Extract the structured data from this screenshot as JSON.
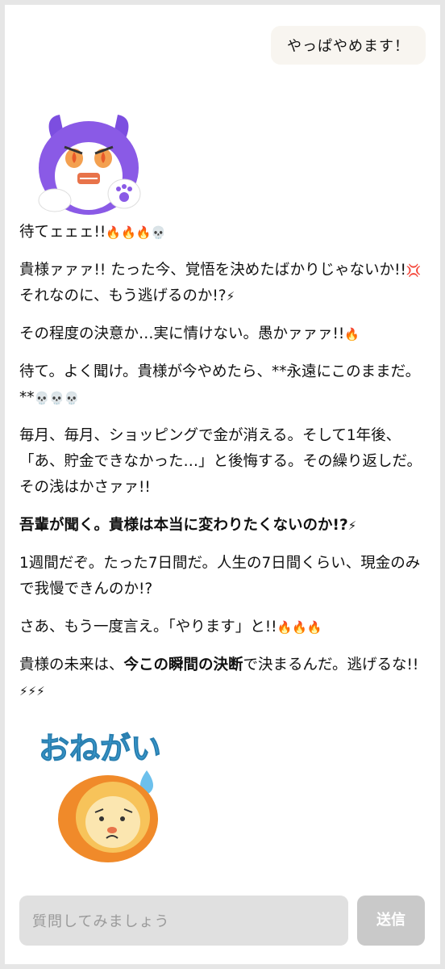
{
  "user_message": "やっぱやめます！",
  "reply": {
    "line1_text": "待てェェェ!!",
    "line1_emoji": "🔥🔥🔥💀",
    "p2_a": "貴様ァァァ!! たった今、覚悟を決めたばかりじゃないか!!",
    "p2_emoji1": "💢",
    "p2_b": "それなのに、もう逃げるのか!?",
    "p2_emoji2": "⚡",
    "p3_text": "その程度の決意か…実に情けない。愚かァァァ!!",
    "p3_emoji": "🔥",
    "p4_text": "待て。よく聞け。貴様が今やめたら、**永遠にこのままだ。**",
    "p4_emoji": "💀💀💀",
    "p5_text": "毎月、毎月、ショッピングで金が消える。そして1年後、「あ、貯金できなかった…」と後悔する。その繰り返しだ。その浅はかさァァ!!",
    "p6_text": "吾輩が聞く。貴様は本当に変わりたくないのか!?",
    "p6_emoji": "⚡",
    "p7_text": "1週間だぞ。たった7日間だ。人生の7日間くらい、現金のみで我慢できんのか!?",
    "p8_text": "さあ、もう一度言え。「やります」と!!",
    "p8_emoji": "🔥🔥🔥",
    "p9_a": "貴様の未来は、",
    "p9_bold": "今この瞬間の決断",
    "p9_b": "で決まるんだ。逃げるな!!",
    "p9_emoji": "⚡⚡⚡"
  },
  "sticker_text": "おねがい",
  "input": {
    "placeholder": "質問してみましょう"
  },
  "send_label": "送信",
  "colors": {
    "user_bubble_bg": "#f8f5f0",
    "input_bg": "#e0e0e0",
    "send_button_bg": "#c9c9c9",
    "avatar_purple": "#7c4ee0",
    "sticker_blue": "#3fa3d8",
    "sticker_orange": "#f08a2a"
  }
}
